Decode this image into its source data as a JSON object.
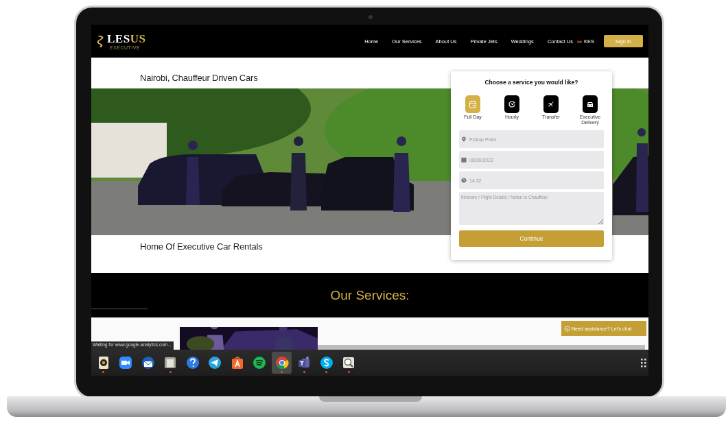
{
  "nav": {
    "logo": {
      "wordmark": [
        {
          "text": "LES",
          "accent": false
        },
        {
          "text": "US",
          "accent": true
        }
      ],
      "tagline": "EXECUTIVE"
    },
    "links": [
      {
        "label": "Home"
      },
      {
        "label": "Our Services"
      },
      {
        "label": "About Us"
      },
      {
        "label": "Private Jets"
      },
      {
        "label": "Weddings"
      },
      {
        "label": "Contact Us"
      }
    ],
    "currency": "KES",
    "sign_in": "Sign In"
  },
  "hero": {
    "title": "Nairobi, Chauffeur Driven Cars",
    "subtitle": "Home Of Executive Car Rentals"
  },
  "booking": {
    "title": "Choose a service you would like?",
    "services": [
      {
        "label": "Full Day",
        "selected": true
      },
      {
        "label": "Hourly",
        "selected": false
      },
      {
        "label": "Transfer",
        "selected": false
      },
      {
        "label": "Executive Delivery",
        "selected": false
      }
    ],
    "fields": [
      {
        "kind": "location",
        "placeholder": "Pickup Point"
      },
      {
        "kind": "date",
        "placeholder": "08/30/2022"
      },
      {
        "kind": "time",
        "placeholder": "14:32"
      },
      {
        "kind": "notes",
        "placeholder": "Itinerary / Flight Details / Notes to Chauffeur"
      }
    ],
    "submit": "Continue"
  },
  "services_section": {
    "title": "Our Services:"
  },
  "chat_button": "Need assistance? Let's chat",
  "status_text": "Waiting for www.google-analytics.com...",
  "dock": [
    {
      "running": true,
      "selected": false
    },
    {
      "running": false,
      "selected": false
    },
    {
      "running": false,
      "selected": false
    },
    {
      "running": true,
      "selected": false
    },
    {
      "running": false,
      "selected": false
    },
    {
      "running": false,
      "selected": false
    },
    {
      "running": false,
      "selected": false
    },
    {
      "running": false,
      "selected": false
    },
    {
      "running": true,
      "selected": true
    },
    {
      "running": true,
      "selected": false
    },
    {
      "running": true,
      "selected": false
    },
    {
      "running": true,
      "selected": false
    }
  ]
}
